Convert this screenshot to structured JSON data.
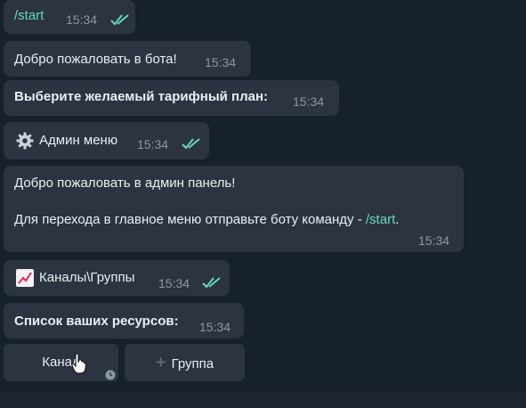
{
  "messages": [
    {
      "id": "m1",
      "text": "/start",
      "time": "15:34",
      "outgoing": true
    },
    {
      "id": "m2",
      "text": "Добро пожаловать в бота!",
      "time": "15:34"
    },
    {
      "id": "m3",
      "text": "Выберите желаемый тарифный план:",
      "time": "15:34"
    },
    {
      "id": "m4",
      "icon": "gear-icon",
      "text": "Админ меню",
      "time": "15:34",
      "outgoing": true
    },
    {
      "id": "m5",
      "line1": "Добро пожаловать в админ панель!",
      "line2_prefix": "Для перехода в главное меню отправьте боту команду - ",
      "line2_cmd": "/start",
      "line2_suffix": ".",
      "time": "15:34"
    },
    {
      "id": "m6",
      "icon": "chart-increasing-icon",
      "text": "Каналы\\Группы",
      "time": "15:34",
      "outgoing": true
    },
    {
      "id": "m7",
      "text": "Список ваших ресурсов:",
      "time": "15:34"
    }
  ],
  "keyboard": {
    "button1": {
      "label": "Канал"
    },
    "button2": {
      "plus": "+",
      "label": "Группа"
    }
  },
  "colors": {
    "background": "#17212b",
    "bubble": "#2b3440",
    "accent": "#67d7c0",
    "time": "#8b98a5"
  }
}
